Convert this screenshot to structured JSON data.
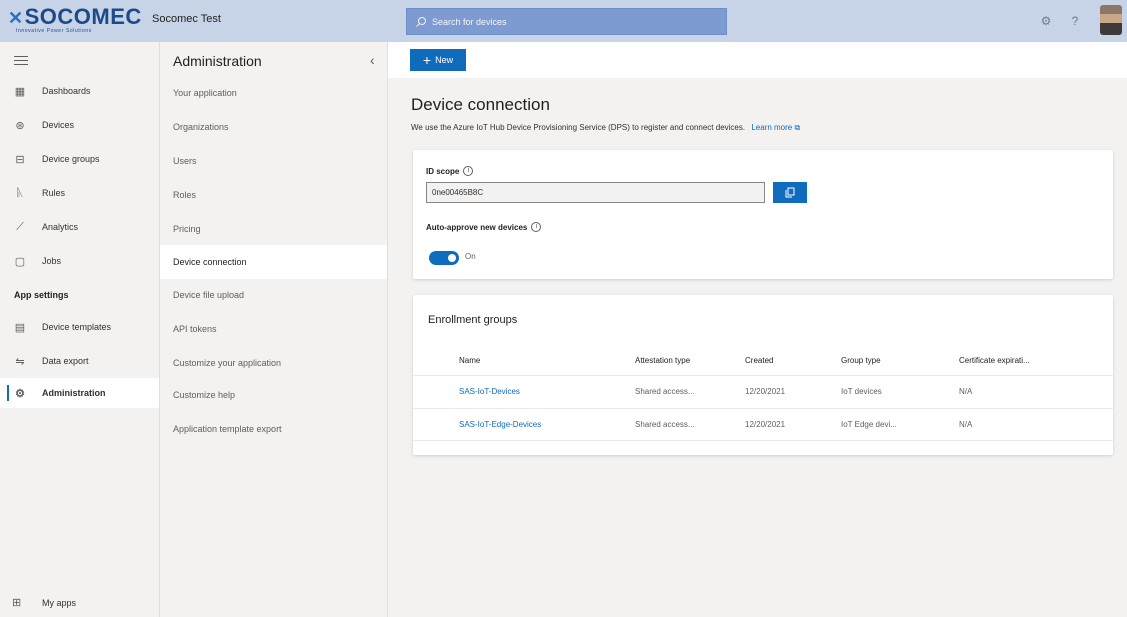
{
  "topbar": {
    "logo_text": "SOCOMEC",
    "logo_tagline": "Innovative Power Solutions",
    "app_name": "Socomec Test",
    "search_placeholder": "Search for devices"
  },
  "leftnav": {
    "items": [
      {
        "label": "Dashboards",
        "icon": "dashboard-icon"
      },
      {
        "label": "Devices",
        "icon": "devices-icon"
      },
      {
        "label": "Device groups",
        "icon": "device-groups-icon"
      },
      {
        "label": "Rules",
        "icon": "rules-icon"
      },
      {
        "label": "Analytics",
        "icon": "analytics-icon"
      },
      {
        "label": "Jobs",
        "icon": "jobs-icon"
      }
    ],
    "section_label": "App settings",
    "settings_items": [
      {
        "label": "Device templates",
        "icon": "device-templates-icon"
      },
      {
        "label": "Data export",
        "icon": "data-export-icon"
      },
      {
        "label": "Administration",
        "icon": "administration-icon",
        "active": true
      }
    ],
    "my_apps": "My apps"
  },
  "admin": {
    "title": "Administration",
    "items": [
      "Your application",
      "Organizations",
      "Users",
      "Roles",
      "Pricing",
      "Device connection",
      "Device file upload",
      "API tokens",
      "Customize your application",
      "Customize help",
      "Application template export"
    ],
    "active_item": "Device connection"
  },
  "main": {
    "new_label": "New",
    "title": "Device connection",
    "description": "We use the Azure IoT Hub Device Provisioning Service (DPS) to register and connect devices.",
    "learn_more": "Learn more",
    "id_scope_label": "ID scope",
    "id_scope_value": "0ne00465B8C",
    "auto_approve_label": "Auto-approve new devices",
    "auto_approve_state": "On",
    "enrollment_title": "Enrollment groups",
    "columns": [
      "Name",
      "Attestation type",
      "Created",
      "Group type",
      "Certificate expirati..."
    ],
    "rows": [
      [
        "SAS-IoT-Devices",
        "Shared access...",
        "12/20/2021",
        "IoT devices",
        "N/A"
      ],
      [
        "SAS-IoT-Edge-Devices",
        "Shared access...",
        "12/20/2021",
        "IoT Edge devi...",
        "N/A"
      ]
    ]
  },
  "colors": {
    "accent": "#0f6cbd",
    "topbar": "#c7d3e6",
    "search": "#7d9bd1",
    "brand": "#1b4b8a"
  }
}
